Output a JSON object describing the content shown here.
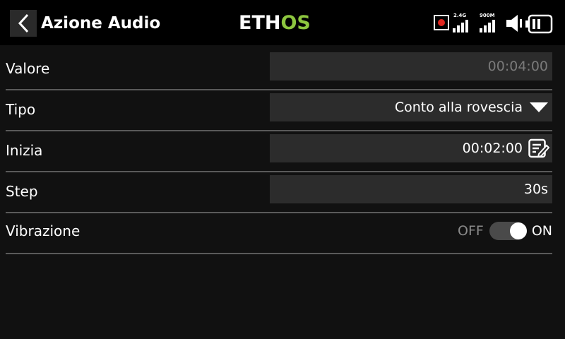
{
  "header": {
    "title": "Azione Audio",
    "logo_part1": "ETH",
    "logo_part2": "OS",
    "radio_24": "2.4G",
    "radio_900": "900M"
  },
  "rows": {
    "valore": {
      "label": "Valore",
      "value": "00:04:00"
    },
    "tipo": {
      "label": "Tipo",
      "value": "Conto alla rovescia"
    },
    "inizia": {
      "label": "Inizia",
      "value": "00:02:00"
    },
    "step": {
      "label": "Step",
      "value": "30s"
    },
    "vibrazione": {
      "label": "Vibrazione",
      "off_label": "OFF",
      "on_label": "ON",
      "state": "on"
    }
  },
  "colors": {
    "accent_green": "#8dc63f",
    "record_red": "#e0261f",
    "background": "#111111",
    "field": "#2c2c2c"
  }
}
